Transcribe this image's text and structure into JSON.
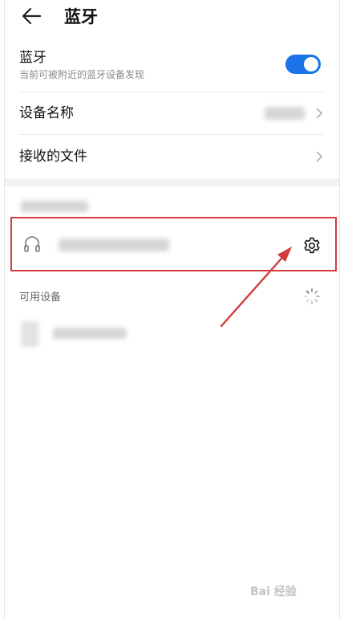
{
  "header": {
    "title": "蓝牙",
    "back_icon": "arrow-left-icon"
  },
  "bluetooth_row": {
    "label": "蓝牙",
    "subtitle": "当前可被附近的蓝牙设备发现",
    "toggle_on": true,
    "accent_color": "#1a73e8"
  },
  "device_name_row": {
    "label": "设备名称"
  },
  "received_files_row": {
    "label": "接收的文件"
  },
  "paired_device": {
    "icon": "headphone-icon",
    "settings_icon": "gear-icon",
    "highlight_color": "#d23c3c"
  },
  "available_section": {
    "title": "可用设备",
    "status_icon": "loading-spinner-icon"
  },
  "watermark": {
    "text": "Bai 经验"
  }
}
